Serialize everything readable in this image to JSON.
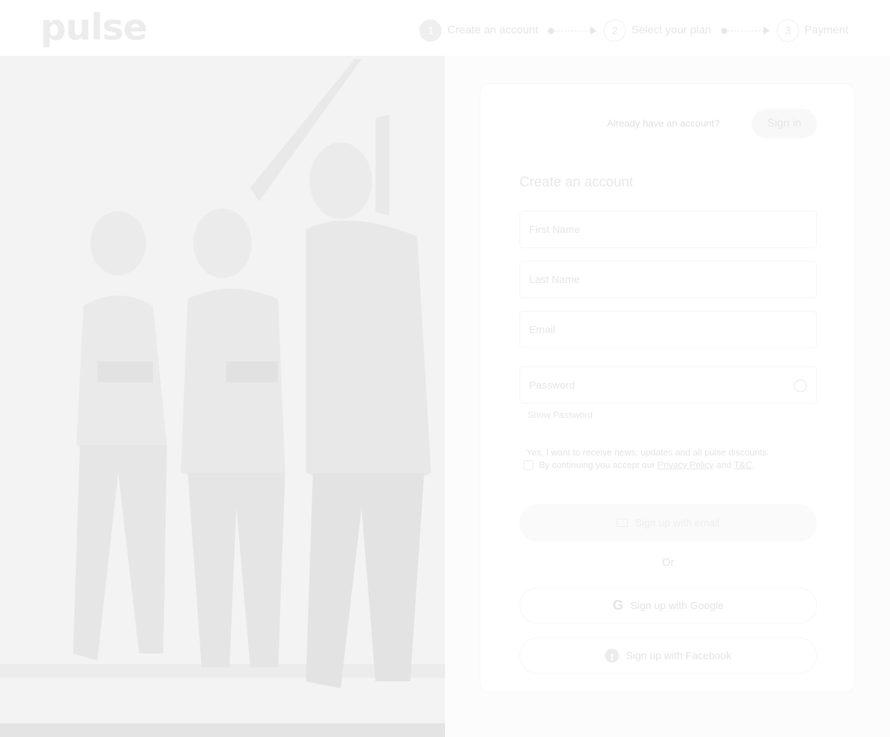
{
  "header": {
    "logo": "pulse",
    "steps": [
      {
        "num": "1",
        "label": "Create an account"
      },
      {
        "num": "2",
        "label": "Select your plan"
      },
      {
        "num": "3",
        "label": "Payment"
      }
    ]
  },
  "card": {
    "already_text": "Already have an account?",
    "signin_label": "Sign in",
    "title": "Create an account",
    "first_name_placeholder": "First Name",
    "last_name_placeholder": "Last Name",
    "email_placeholder": "Email",
    "password_placeholder": "Password",
    "show_password": "Show Password",
    "newsletter_text": "Yes, I want to receive news, updates and all pulse discounts.",
    "terms_prefix": "By continuing you accept our",
    "privacy_link": "Privacy Policy",
    "terms_and": "and",
    "tc_link": "T&C",
    "terms_suffix": ".",
    "signup_email_label": "Sign up with email",
    "or_text": "Or",
    "google_label": "Sign up with Google",
    "facebook_label": "Sign up with Facebook"
  },
  "colors": {
    "page_bg": "#ffffff",
    "text_faint": "#e6e6e6"
  }
}
